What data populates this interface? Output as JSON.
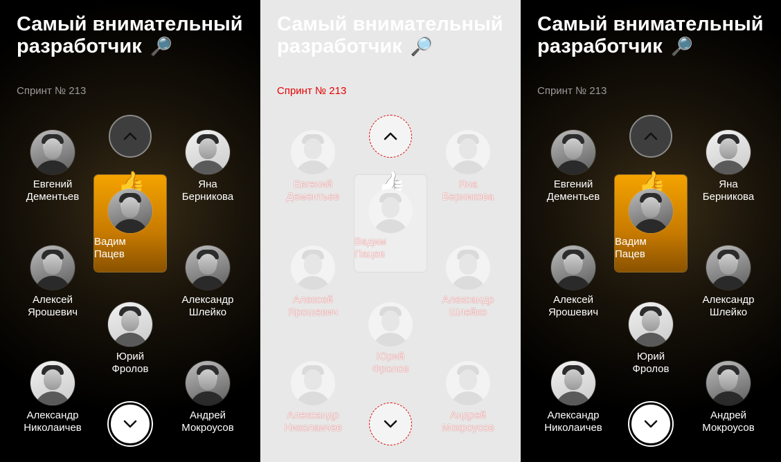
{
  "screen": {
    "title": "Самый внимательный разработчик",
    "title_emoji": "🔎",
    "subtitle": "Спринт № 213",
    "leader_emoji": "👍",
    "nav_up_icon": "chevron-up-icon",
    "nav_down_icon": "chevron-down-icon"
  },
  "people": [
    {
      "name_first": "Евгений",
      "name_last": "Дементьев"
    },
    {
      "name_first": "Яна",
      "name_last": "Берникова"
    },
    {
      "name_first": "Вадим",
      "name_last": "Пацев"
    },
    {
      "name_first": "Алексей",
      "name_last": "Ярошевич"
    },
    {
      "name_first": "Александр",
      "name_last": "Шлейко"
    },
    {
      "name_first": "Юрий",
      "name_last": "Фролов"
    },
    {
      "name_first": "Александр",
      "name_last": "Николаичев"
    },
    {
      "name_first": "Андрей",
      "name_last": "Мокроусов"
    }
  ],
  "colors": {
    "leader_gold": "#f4a300",
    "panel_dark": "#000000",
    "panel_light": "#e8e8e8",
    "diff_red": "#e40000"
  }
}
